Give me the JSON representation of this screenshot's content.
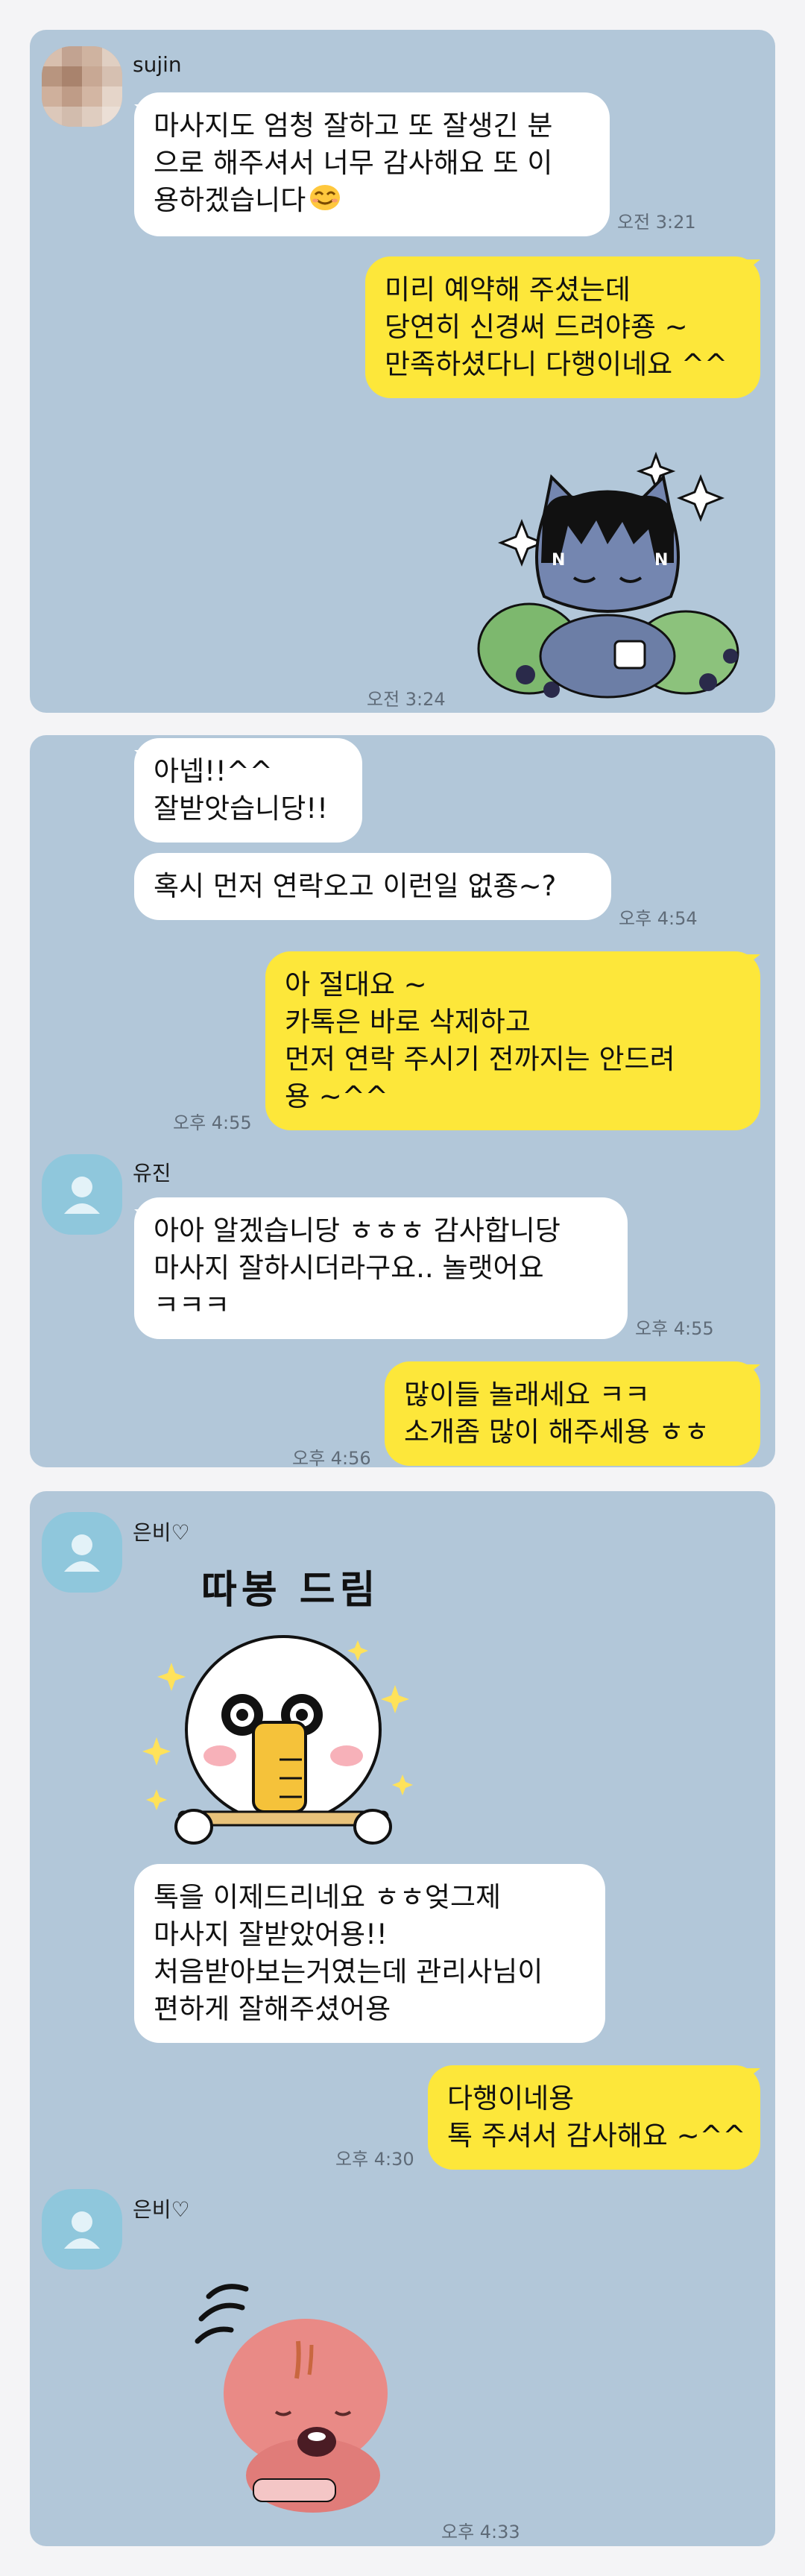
{
  "panel1": {
    "sender": "sujin",
    "msg1": {
      "lines": [
        "마사지도 엄청 잘하고 또 잘생긴 분",
        "으로 해주셔서 너무 감사해요 또 이",
        "용하겠습니다"
      ],
      "time": "오전 3:21"
    },
    "reply1": {
      "lines": [
        "미리 예약해 주셨는데",
        "당연히 신경써 드려야죵 ~",
        "만족하셨다니 다행이네요 ^^"
      ]
    },
    "sticker_time": "오전 3:24"
  },
  "panel2": {
    "msg1": {
      "lines": [
        "아넵!!^^",
        "잘받앗습니당!!"
      ]
    },
    "msg2": {
      "lines": [
        "혹시 먼저 연락오고 이런일 없죵~?"
      ],
      "time": "오후 4:54"
    },
    "reply1": {
      "lines": [
        "아 절대요 ~",
        "카톡은 바로 삭제하고",
        "먼저 연락 주시기 전까지는 안드려",
        "용 ~^^"
      ],
      "time": "오후 4:55"
    },
    "sender": "유진",
    "msg3": {
      "lines": [
        "아아 알겠습니당 ㅎㅎㅎ 감사합니당",
        "마사지 잘하시더라구요.. 놀랫어요",
        "ㅋㅋㅋ"
      ],
      "time": "오후 4:55"
    },
    "reply2": {
      "lines": [
        "많이들 놀래세요 ㅋㅋ",
        "소개좀 많이 해주세용 ㅎㅎ"
      ],
      "time": "오후 4:56"
    }
  },
  "panel3": {
    "sender1": "은비♡",
    "sticker_caption": "따봉 드림",
    "msg1": {
      "lines": [
        "톡을 이제드리네요 ㅎㅎ엊그제",
        "마사지 잘받았어용!!",
        "처음받아보는거였는데 관리사님이",
        "편하게 잘해주셨어용"
      ]
    },
    "reply1": {
      "lines": [
        "다행이네용",
        "톡 주셔서 감사해요 ~^^"
      ],
      "time": "오후 4:30"
    },
    "sender2": "은비♡",
    "sticker_time": "오후 4:33"
  }
}
